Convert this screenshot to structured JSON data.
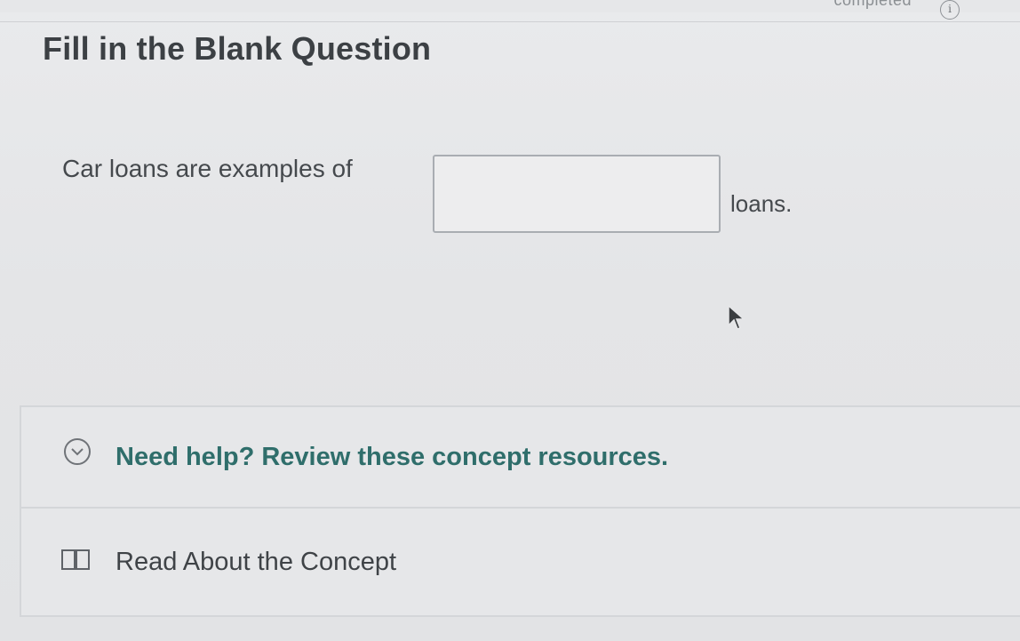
{
  "header": {
    "status_text": "completed",
    "info_symbol": "i"
  },
  "question": {
    "title": "Fill in the Blank Question",
    "prefix_text": "Car loans are examples of",
    "answer_value": "",
    "suffix_text": "loans."
  },
  "help": {
    "title": "Need help? Review these concept resources.",
    "resources": [
      {
        "label": "Read About the Concept",
        "icon": "book-icon"
      }
    ]
  },
  "icons": {
    "info": "info-icon",
    "expand": "chevron-down-icon",
    "cursor": "mouse-pointer-icon"
  },
  "colors": {
    "accent": "#2f6e6b",
    "text": "#3f4347",
    "background": "#e6e7e9"
  }
}
